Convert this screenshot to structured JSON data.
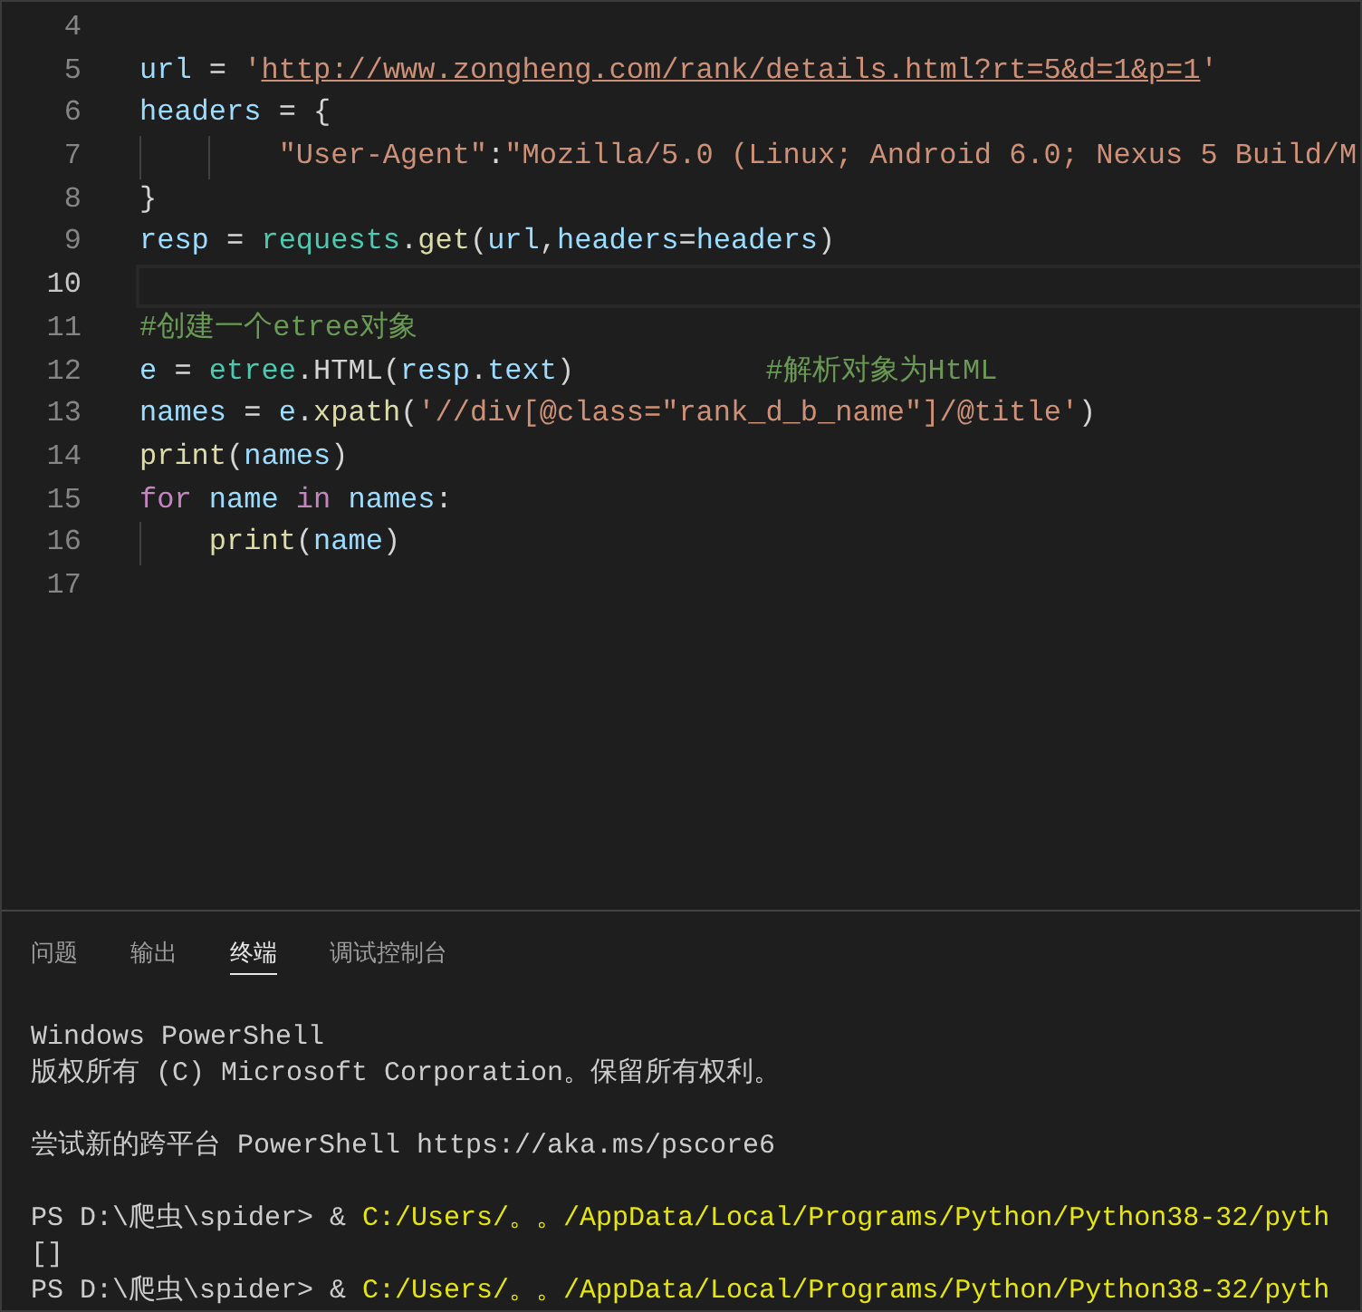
{
  "editor": {
    "lines": [
      {
        "number": "4",
        "current": false
      },
      {
        "number": "5",
        "current": false,
        "tokens": [
          {
            "kind": "var",
            "text": "url"
          },
          {
            "kind": "plain",
            "text": " = "
          },
          {
            "kind": "str",
            "text": "'"
          },
          {
            "kind": "link",
            "text": "http://www.zongheng.com/rank/details.html?rt=5&d=1&p=1"
          },
          {
            "kind": "str",
            "text": "'"
          }
        ]
      },
      {
        "number": "6",
        "current": false,
        "tokens": [
          {
            "kind": "var",
            "text": "headers"
          },
          {
            "kind": "plain",
            "text": " = {"
          }
        ]
      },
      {
        "number": "7",
        "current": false,
        "tokens": [
          {
            "kind": "str",
            "text": "        \"User-Agent\""
          },
          {
            "kind": "plain",
            "text": ":"
          },
          {
            "kind": "str",
            "text": "\"Mozilla/5.0 (Linux; Android 6.0; Nexus 5 Build/M"
          }
        ]
      },
      {
        "number": "8",
        "current": false,
        "tokens": [
          {
            "kind": "plain",
            "text": "}"
          }
        ]
      },
      {
        "number": "9",
        "current": false,
        "tokens": [
          {
            "kind": "var",
            "text": "resp"
          },
          {
            "kind": "plain",
            "text": " = "
          },
          {
            "kind": "module",
            "text": "requests"
          },
          {
            "kind": "plain",
            "text": "."
          },
          {
            "kind": "func",
            "text": "get"
          },
          {
            "kind": "plain",
            "text": "("
          },
          {
            "kind": "var",
            "text": "url"
          },
          {
            "kind": "plain",
            "text": ","
          },
          {
            "kind": "var",
            "text": "headers"
          },
          {
            "kind": "plain",
            "text": "="
          },
          {
            "kind": "var",
            "text": "headers"
          },
          {
            "kind": "plain",
            "text": ")"
          }
        ]
      },
      {
        "number": "10",
        "current": true
      },
      {
        "number": "11",
        "current": false,
        "tokens": [
          {
            "kind": "comment",
            "text": "#创建一个etree对象"
          }
        ]
      },
      {
        "number": "12",
        "current": false,
        "tokens": [
          {
            "kind": "var",
            "text": "e"
          },
          {
            "kind": "plain",
            "text": " = "
          },
          {
            "kind": "module",
            "text": "etree"
          },
          {
            "kind": "plain",
            "text": ".HTML("
          },
          {
            "kind": "var",
            "text": "resp"
          },
          {
            "kind": "plain",
            "text": "."
          },
          {
            "kind": "var",
            "text": "text"
          },
          {
            "kind": "plain",
            "text": ")"
          },
          {
            "kind": "comment",
            "text": "           #解析对象为HtML"
          }
        ]
      },
      {
        "number": "13",
        "current": false,
        "tokens": [
          {
            "kind": "var",
            "text": "names"
          },
          {
            "kind": "plain",
            "text": " = "
          },
          {
            "kind": "var",
            "text": "e"
          },
          {
            "kind": "plain",
            "text": "."
          },
          {
            "kind": "func",
            "text": "xpath"
          },
          {
            "kind": "plain",
            "text": "("
          },
          {
            "kind": "str",
            "text": "'//div[@class=\"rank_d_b_name\"]/@title'"
          },
          {
            "kind": "plain",
            "text": ")"
          }
        ]
      },
      {
        "number": "14",
        "current": false,
        "tokens": [
          {
            "kind": "func",
            "text": "print"
          },
          {
            "kind": "plain",
            "text": "("
          },
          {
            "kind": "var",
            "text": "names"
          },
          {
            "kind": "plain",
            "text": ")"
          }
        ]
      },
      {
        "number": "15",
        "current": false,
        "tokens": [
          {
            "kind": "keyword",
            "text": "for"
          },
          {
            "kind": "var",
            "text": " name"
          },
          {
            "kind": "keyword",
            "text": " in"
          },
          {
            "kind": "var",
            "text": " names"
          },
          {
            "kind": "plain",
            "text": ":"
          }
        ]
      },
      {
        "number": "16",
        "current": false,
        "tokens": [
          {
            "kind": "func",
            "text": "    print"
          },
          {
            "kind": "plain",
            "text": "("
          },
          {
            "kind": "var",
            "text": "name"
          },
          {
            "kind": "plain",
            "text": ")"
          }
        ]
      },
      {
        "number": "17",
        "current": false
      }
    ]
  },
  "panel": {
    "tabs": [
      {
        "label": "问题",
        "selected": false
      },
      {
        "label": "输出",
        "selected": false
      },
      {
        "label": "终端",
        "selected": true
      },
      {
        "label": "调试控制台",
        "selected": false
      }
    ],
    "terminal": [
      {
        "kind": "text",
        "segments": [
          {
            "kind": "plain",
            "text": "Windows PowerShell"
          }
        ]
      },
      {
        "kind": "text",
        "segments": [
          {
            "kind": "plain",
            "text": "版权所有 (C) Microsoft Corporation。保留所有权利。"
          }
        ]
      },
      {
        "kind": "blank"
      },
      {
        "kind": "text",
        "segments": [
          {
            "kind": "plain",
            "text": "尝试新的跨平台 PowerShell https://aka.ms/pscore6"
          }
        ]
      },
      {
        "kind": "blank"
      },
      {
        "kind": "text",
        "segments": [
          {
            "kind": "plain",
            "text": "PS D:\\爬虫\\spider> & "
          },
          {
            "kind": "path",
            "text": "C:/Users/。。/AppData/Local/Programs/Python/Python38-32/pyth"
          }
        ]
      },
      {
        "kind": "text",
        "segments": [
          {
            "kind": "plain",
            "text": "[]"
          }
        ]
      },
      {
        "kind": "text",
        "segments": [
          {
            "kind": "plain",
            "text": "PS D:\\爬虫\\spider> & "
          },
          {
            "kind": "path",
            "text": "C:/Users/。。/AppData/Local/Programs/Python/Python38-32/pyth"
          }
        ]
      }
    ]
  }
}
